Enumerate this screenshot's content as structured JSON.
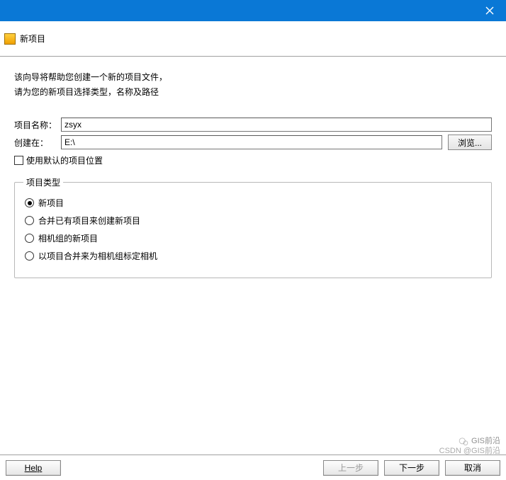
{
  "window": {
    "title": "新项目"
  },
  "intro": {
    "line1": "该向导将帮助您创建一个新的项目文件，",
    "line2": "请为您的新项目选择类型，名称及路径"
  },
  "form": {
    "name_label": "项目名称：",
    "name_value": "zsyx",
    "path_label": "创建在：",
    "path_value": "E:\\",
    "browse_label": "浏览...",
    "use_default_label": "使用默认的项目位置",
    "use_default_checked": false
  },
  "project_type": {
    "legend": "项目类型",
    "options": [
      {
        "label": "新项目",
        "checked": true
      },
      {
        "label": "合并已有项目来创建新项目",
        "checked": false
      },
      {
        "label": "相机组的新项目",
        "checked": false
      },
      {
        "label": "以项目合并来为相机组标定相机",
        "checked": false
      }
    ]
  },
  "footer": {
    "help": "Help",
    "prev": "上一步",
    "next": "下一步",
    "cancel": "取消"
  },
  "watermark": {
    "top": "GIS前沿",
    "bottom": "CSDN @GIS前沿"
  }
}
